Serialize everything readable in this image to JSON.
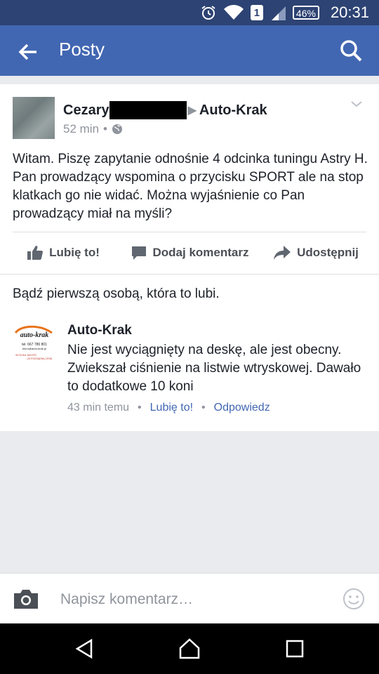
{
  "status_bar": {
    "sim_slot": "1",
    "battery": "46%",
    "time": "20:31",
    "icons": [
      "alarm-icon",
      "wifi-icon",
      "sim-icon",
      "signal-icon",
      "battery-icon"
    ]
  },
  "app_bar": {
    "title": "Posty",
    "back_icon": "arrow-back-icon",
    "search_icon": "search-icon",
    "background": "#4267b2"
  },
  "post": {
    "author_first": "Cezary",
    "target_page": "Auto-Krak",
    "time": "52 min",
    "separator": "•",
    "audience_icon": "globe-icon",
    "text": "Witam. Piszę zapytanie odnośnie 4 odcinka tuningu Astry H. Pan prowadzący wspomina o przycisku SPORT ale na stop klatkach go nie widać. Można wyjaśnienie co Pan prowadzący miał na myśli?",
    "actions": {
      "like": "Lubię to!",
      "comment": "Dodaj komentarz",
      "share": "Udostępnij"
    }
  },
  "likes_summary": "Bądź pierwszą osobą, która to lubi.",
  "comment": {
    "author": "Auto-Krak",
    "text": "Nie jest wyciągnięty na deskę, ale jest obecny. Zwiekszał ciśnienie na listwie wtryskowej. Dawało to dodatkowe 10 koni",
    "time": "43 min temu",
    "like": "Lubię to!",
    "reply": "Odpowiedz",
    "dot": "•",
    "logo": {
      "brand": "auto-krak",
      "phone": "tel. 667 786 801",
      "site": "biuro@auto-krak.pl",
      "slogan1": "WYSOKA JAKOŚĆ",
      "slogan2": "...ZA ROZSĄDNĄ CENĘ"
    }
  },
  "composer": {
    "placeholder": "Napisz komentarz…"
  },
  "colors": {
    "status_bar": "#2d4373",
    "link": "#4267b2",
    "muted": "#90949c",
    "text": "#1d2129"
  }
}
